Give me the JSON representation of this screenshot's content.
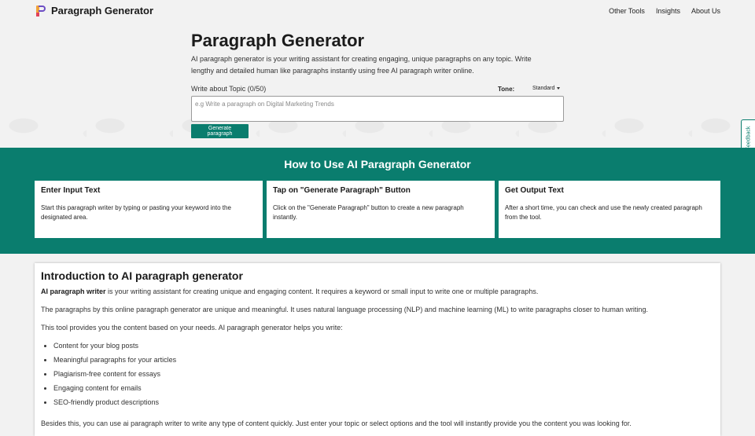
{
  "header": {
    "logo_text": "Paragraph Generator",
    "nav": [
      "Other Tools",
      "Insights",
      "About Us"
    ]
  },
  "hero": {
    "title": "Paragraph Generator",
    "description": "AI paragraph generator is your writing assistant for creating engaging, unique paragraphs on any topic. Write lengthy and detailed human like paragraphs instantly using free AI paragraph writer online.",
    "topic_label": "Write about Topic (0/50)",
    "tone_label": "Tone:",
    "tone_value": "Standard",
    "input_placeholder": "e.g Write a paragraph on Digital Marketing Trends",
    "button_label": "Generate paragraph"
  },
  "feedback_label": "Feedback",
  "howto": {
    "title": "How to Use AI Paragraph Generator",
    "steps": [
      {
        "title": "Enter Input Text",
        "desc": "Start this paragraph writer by typing or pasting your keyword into the designated area."
      },
      {
        "title": "Tap on \"Generate Paragraph\" Button",
        "desc": "Click on the \"Generate Paragraph\" button to create a new paragraph instantly."
      },
      {
        "title": "Get Output Text",
        "desc": "After a short time, you can check and use the newly created paragraph from the tool."
      }
    ]
  },
  "intro": {
    "title": "Introduction to AI paragraph generator",
    "p1_bold": "AI paragraph writer",
    "p1_rest": " is your writing assistant for creating unique and engaging content. It requires a keyword or small input to write one or multiple paragraphs.",
    "p2": "The paragraphs by this online paragraph generator are unique and meaningful. It uses natural language processing (NLP) and machine learning (ML) to write paragraphs closer to human writing.",
    "p3": "This tool provides you the content based on your needs. AI paragraph generator helps you write:",
    "bullets": [
      "Content for your blog posts",
      "Meaningful paragraphs for your articles",
      "Plagiarism-free content for essays",
      "Engaging content for emails",
      "SEO-friendly product descriptions"
    ],
    "p4": "Besides this, you can use ai paragraph writer to write any type of content quickly. Just enter your topic or select options and the tool will instantly provide you the content you was looking for."
  },
  "colors": {
    "accent": "#0a7d6e",
    "page_bg": "#f2f2f2"
  }
}
